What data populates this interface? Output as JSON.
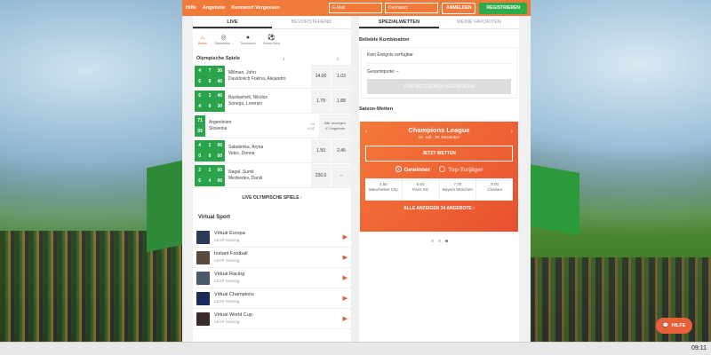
{
  "topbar": {
    "links": [
      "Hilfe",
      "Angebote",
      "Kennwort Vergessen"
    ],
    "email_placeholder": "E-Mail",
    "password_placeholder": "Kennwort",
    "login": "ANMELDEN",
    "register": "REGISTRIEREN"
  },
  "left_tabs": [
    "LIVE",
    "BEVORSTEHEND"
  ],
  "sports": [
    {
      "label": "Befehl",
      "icon": "flame-icon"
    },
    {
      "label": "Olympische...",
      "icon": "olympic-rings-icon"
    },
    {
      "label": "Tischtennis",
      "icon": "table-tennis-icon"
    },
    {
      "label": "Virtual Sport",
      "icon": "soccer-ball-icon"
    }
  ],
  "olympic": {
    "title": "Olympische Spiele",
    "col1": "1",
    "col2": "2",
    "matches": [
      {
        "score": [
          "4",
          "7",
          "30",
          "6",
          "6",
          "40"
        ],
        "p1": "Millman, John",
        "p2": "Davidovich Fokina, Alejandro",
        "o1": "14.00",
        "o2": "1.03"
      },
      {
        "score": [
          "6",
          "3",
          "40",
          "4",
          "6",
          "30"
        ],
        "p1": "Basilashvili, Nikoloz",
        "p2": "Sonego, Lorenzo",
        "o1": "1.79",
        "o2": "1.88"
      },
      {
        "score": [
          "71",
          "93"
        ],
        "p1": "Argentinien",
        "p2": "Slowenia",
        "minute": "04",
        "time": "6:42",
        "more1": "Alle anzeigen",
        "more2": "47 Angebote"
      },
      {
        "score": [
          "4",
          "1",
          "00",
          "0",
          "0",
          "00"
        ],
        "p1": "Sabalenka, Aryna",
        "p2": "Vekic, Donna",
        "o1": "1.50",
        "o2": "2.45"
      },
      {
        "score": [
          "2",
          "1",
          "00",
          "6",
          "4",
          "00"
        ],
        "p1": "Nagal, Sumit",
        "p2": "Medvedev, Daniil",
        "o1": "226.0",
        "o2": "--"
      }
    ],
    "more": "LIVE OLYMPISCHE SPIELE"
  },
  "virtual": {
    "title": "Virtual Sport",
    "items": [
      {
        "name": "Virtual Europa",
        "sub": "LEAP Gaming"
      },
      {
        "name": "Instant Football",
        "sub": "LEAP Gaming"
      },
      {
        "name": "Virtual Racing",
        "sub": "LEAP Gaming"
      },
      {
        "name": "Virtual Champions",
        "sub": "LEAP Gaming"
      },
      {
        "name": "Virtual World Cup",
        "sub": "LEAP Gaming"
      }
    ]
  },
  "right_tabs": [
    "SPEZIALWETTEN",
    "MEINE FAVORITEN"
  ],
  "combo": {
    "title": "Beliebte Kombination",
    "empty": "Kein Ereignis verfügbar",
    "quote": "Gesamtquote: –",
    "button": "ZUM WETTSCHEIN HINZUFÜGEN"
  },
  "season": {
    "title": "Saison-Wetten",
    "card_title": "Champions League",
    "date": "15. Juli - 30. Dezember",
    "bet": "JETZT WETTEN",
    "radio_on": "Gewinner",
    "radio_off": "Top-Torjäger",
    "outcomes": [
      {
        "odd": "4.50",
        "team": "Manchester City"
      },
      {
        "odd": "6.00",
        "team": "Paris SG"
      },
      {
        "odd": "7.00",
        "team": "Bayern München"
      },
      {
        "odd": "9.00",
        "team": "Chelsea"
      }
    ],
    "all": "ALLE ANZEIGEN 34 ANGEBOTE"
  },
  "help": "HILFE",
  "clock": "09:11",
  "colors": {
    "accent": "#f07a3a",
    "live_green": "#2aa34a",
    "register_green": "#2bab4a"
  }
}
